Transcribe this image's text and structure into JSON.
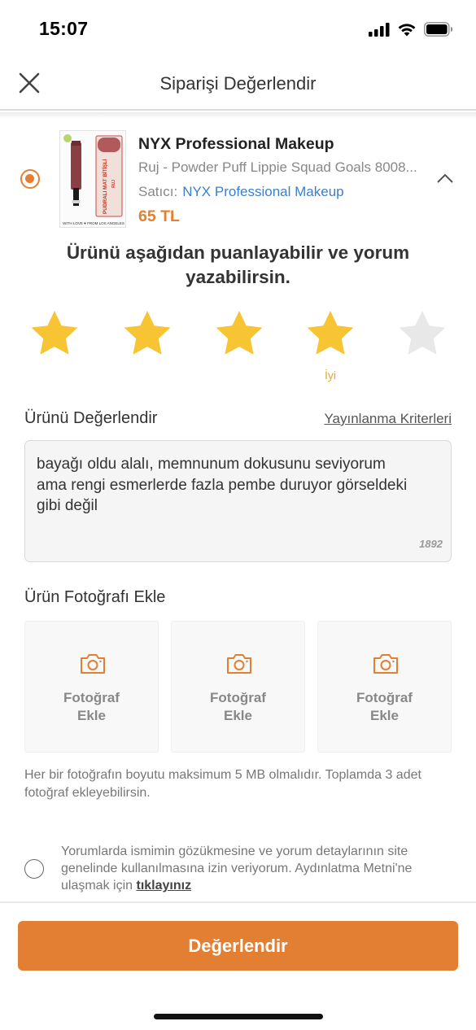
{
  "status_bar": {
    "time": "15:07",
    "icons": [
      "cellular-signal-icon",
      "wifi-icon",
      "battery-icon"
    ]
  },
  "nav": {
    "close_icon": "close-icon",
    "title": "Siparişi Değerlendir"
  },
  "product": {
    "selected": true,
    "thumbnail_texts": {
      "vertical_label": "PUDRALI MAT BİTİŞLİ",
      "sub_label": "RUJ",
      "footer": "WITH LOVE ♥ FROM LOS ANGELES"
    },
    "brand": "NYX Professional Makeup",
    "name": "Ruj - Powder Puff Lippie Squad Goals 8008...",
    "seller_label": "Satıcı:",
    "seller_name": "NYX Professional Makeup",
    "price": "65 TL",
    "expand_icon": "chevron-up-icon"
  },
  "prompt": "Ürünü aşağıdan puanlayabilir ve yorum yazabilirsin.",
  "rating": {
    "value": 4,
    "max": 5,
    "label": "İyi",
    "filled_color": "#f7c433",
    "empty_color": "#e8e8e8"
  },
  "review": {
    "section_title": "Ürünü Değerlendir",
    "criteria_link": "Yayınlanma Kriterleri",
    "text": "bayağı oldu alalı, memnunum dokusunu seviyorum ama rengi esmerlerde fazla pembe duruyor görseldeki gibi değil",
    "char_count": "1892"
  },
  "photos": {
    "section_title": "Ürün Fotoğrafı Ekle",
    "slots": [
      {
        "label_line1": "Fotoğraf",
        "label_line2": "Ekle",
        "icon": "camera-icon"
      },
      {
        "label_line1": "Fotoğraf",
        "label_line2": "Ekle",
        "icon": "camera-icon"
      },
      {
        "label_line1": "Fotoğraf",
        "label_line2": "Ekle",
        "icon": "camera-icon"
      }
    ],
    "note": "Her bir fotoğrafın boyutu maksimum 5 MB olmalıdır. Toplamda 3 adet fotoğraf ekleyebilirsin."
  },
  "consent": {
    "checked": false,
    "text": "Yorumlarda ismimin gözükmesine ve yorum detaylarının site genelinde kullanılmasına izin veriyorum. Aydınlatma Metni'ne ulaşmak için ",
    "link": "tıklayınız"
  },
  "submit": {
    "label": "Değerlendir"
  },
  "colors": {
    "accent": "#e37f32",
    "link_blue": "#3c7fc8",
    "star": "#f7c433"
  }
}
